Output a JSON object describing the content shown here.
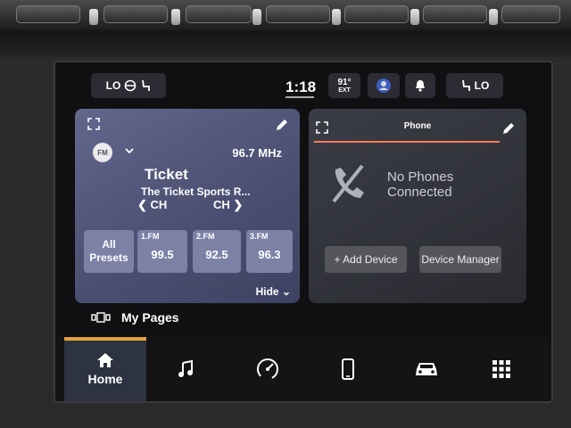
{
  "status_bar": {
    "left_climate": "LO",
    "time": "1:18",
    "temperature": "91°",
    "temperature_mode": "EXT",
    "right_climate": "LO"
  },
  "radio": {
    "band_badge": "FM",
    "frequency": "96.7 MHz",
    "station_name": "Ticket",
    "station_sub": "The Ticket Sports R...",
    "ch_prev": "CH",
    "ch_next": "CH",
    "all_presets": "All Presets",
    "presets": [
      {
        "label": "1.FM",
        "value": "99.5"
      },
      {
        "label": "2.FM",
        "value": "92.5"
      },
      {
        "label": "3.FM",
        "value": "96.3"
      }
    ],
    "hide": "Hide"
  },
  "phone": {
    "title": "Phone",
    "status_line1": "No Phones",
    "status_line2": "Connected",
    "add_device": "+ Add Device",
    "device_manager": "Device Manager"
  },
  "my_pages": "My Pages",
  "nav": {
    "home_label": "Home",
    "items": [
      "home-icon",
      "music-icon",
      "speedometer-icon",
      "phone-icon",
      "car-icon",
      "apps-grid-icon"
    ]
  },
  "colors": {
    "accent_orange": "#e3a33a",
    "phone_underline": "#ff7a5a",
    "radio_card": "#5a5f82"
  }
}
